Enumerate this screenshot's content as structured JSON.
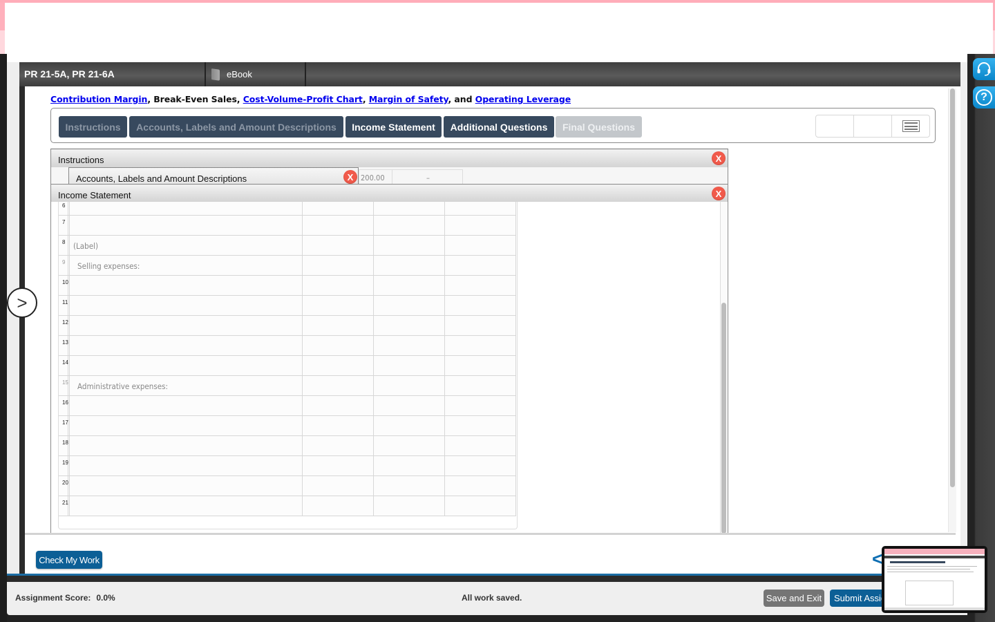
{
  "window": {
    "assignment_title": "PR 21-5A, PR 21-6A",
    "ebook_label": "eBook"
  },
  "heading": {
    "link_contribution_margin": "Contribution Margin",
    "sep1": ", ",
    "plain_break_even": "Break-Even Sales",
    "sep2": ", ",
    "link_cvp_chart": "Cost-Volume-Profit Chart",
    "sep3": ", ",
    "link_margin_safety": "Margin of Safety",
    "sep4": ", and ",
    "link_operating_leverage": "Operating Leverage"
  },
  "tabs": [
    {
      "label": "Instructions",
      "state": "visited"
    },
    {
      "label": "Accounts, Labels and Amount Descriptions",
      "state": "visited"
    },
    {
      "label": "Income Statement",
      "state": "active"
    },
    {
      "label": "Additional Questions",
      "state": "active"
    },
    {
      "label": "Final Questions",
      "state": "disabled"
    }
  ],
  "panels": {
    "instructions_title": "Instructions",
    "accounts_title": "Accounts, Labels and Amount Descriptions",
    "accounts_peek_value": "200.00",
    "accounts_peek_dash": "–",
    "income_statement_title": "Income Statement",
    "close_glyph": "X"
  },
  "income_statement_rows": [
    {
      "num": "6",
      "label": ""
    },
    {
      "num": "7",
      "label": ""
    },
    {
      "num": "8",
      "label": "(Label)"
    },
    {
      "num": "9",
      "label": "Selling expenses:"
    },
    {
      "num": "10",
      "label": ""
    },
    {
      "num": "11",
      "label": ""
    },
    {
      "num": "12",
      "label": ""
    },
    {
      "num": "13",
      "label": ""
    },
    {
      "num": "14",
      "label": ""
    },
    {
      "num": "15",
      "label": "Administrative expenses:"
    },
    {
      "num": "16",
      "label": ""
    },
    {
      "num": "17",
      "label": ""
    },
    {
      "num": "18",
      "label": ""
    },
    {
      "num": "19",
      "label": ""
    },
    {
      "num": "20",
      "label": ""
    },
    {
      "num": "21",
      "label": ""
    }
  ],
  "actions": {
    "check_my_work": "Check My Work",
    "save_and_exit": "Save and Exit",
    "submit_assignment": "Submit Assignment",
    "left_toggle_glyph": ">",
    "next_glyph": "<"
  },
  "footer": {
    "score_label": "Assignment Score:",
    "score_value": "0.0%",
    "save_status": "All work saved."
  },
  "side_buttons": {
    "help_glyph": "?"
  },
  "colors": {
    "tab_bg": "#37495e",
    "primary_button": "#0c5f96",
    "close_red": "#f15a4b",
    "link_blue": "#0000ee"
  }
}
